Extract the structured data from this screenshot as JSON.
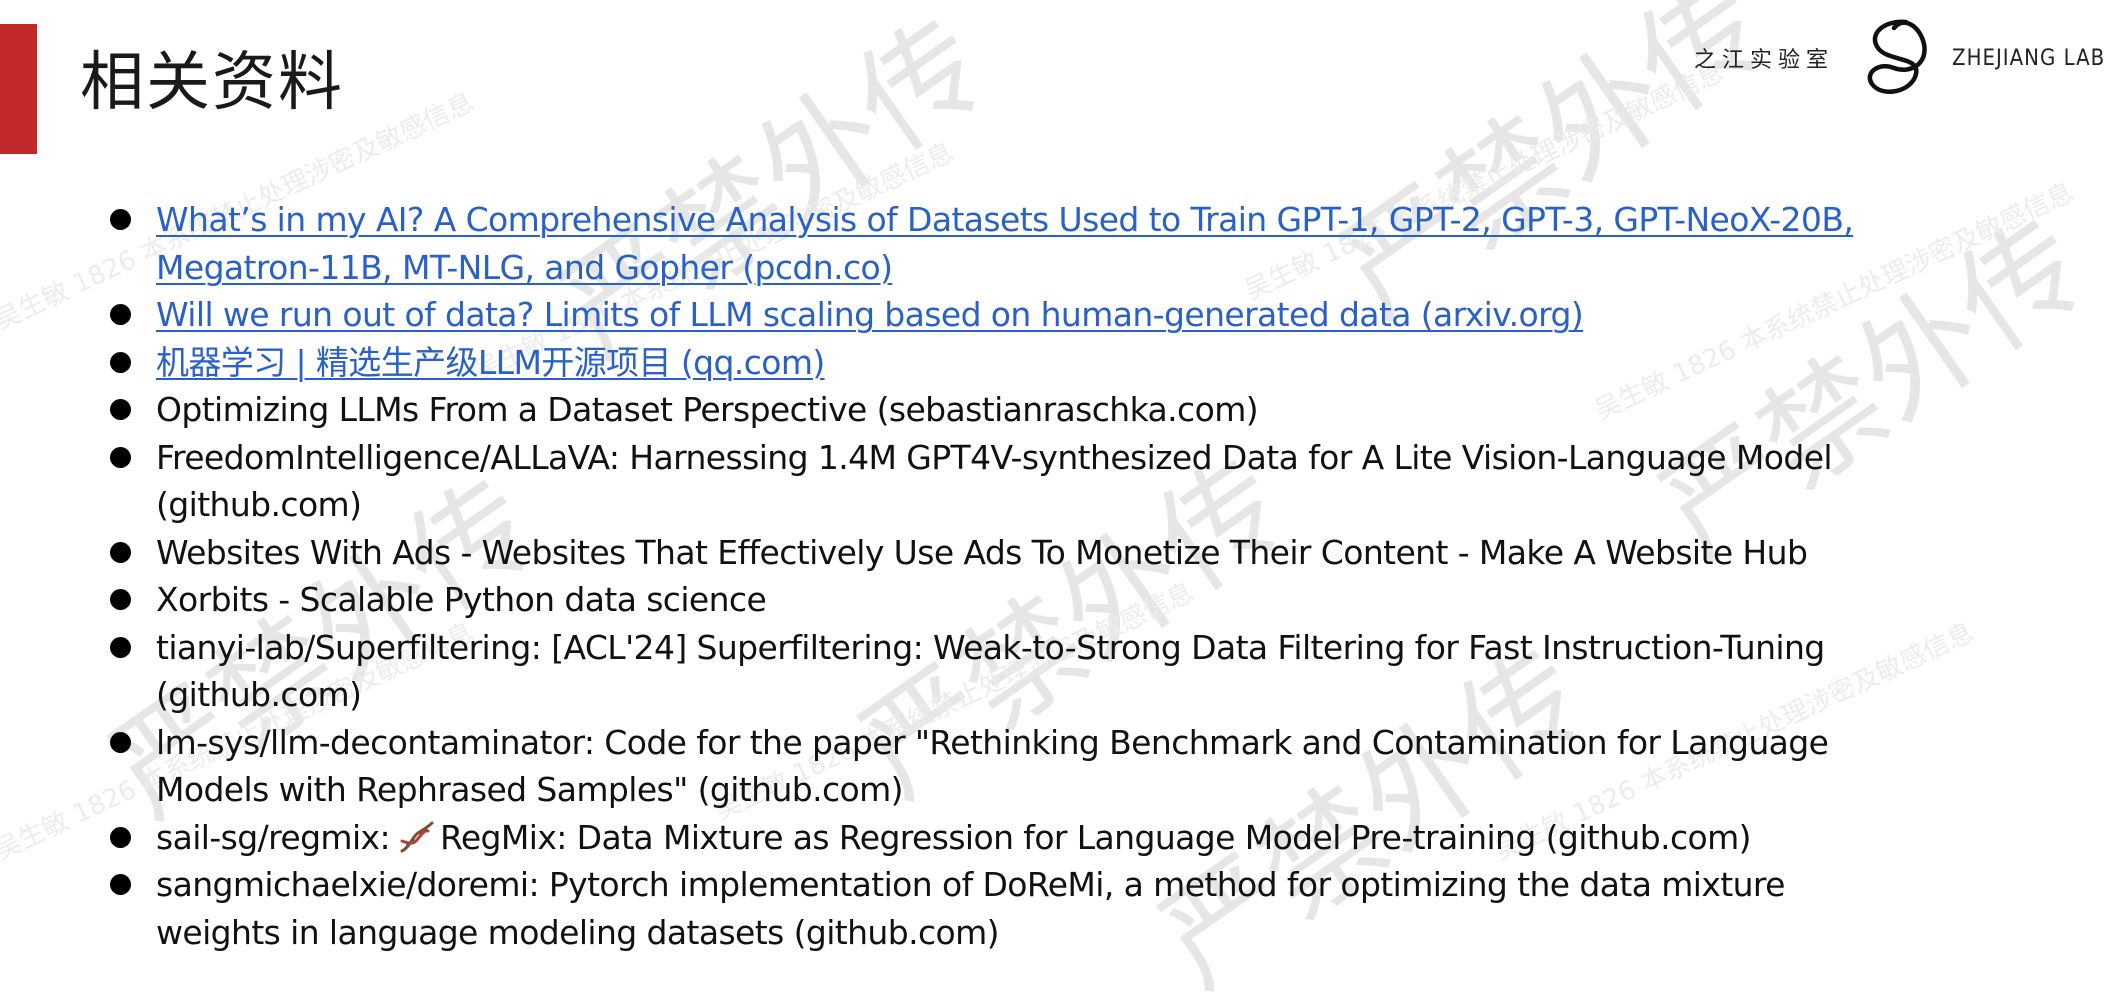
{
  "slide": {
    "title": "相关资料",
    "accent_color": "#c0282a",
    "link_color": "#2a61c6"
  },
  "logo": {
    "cn_name": "之江实验室",
    "en_name": "ZHEJIANG LAB"
  },
  "watermark": {
    "large_text": "严禁外传",
    "small_text": "吴生敏 1826 本系统禁止处理涉密及敏感信息"
  },
  "references": [
    {
      "text": "What’s in my AI? A Comprehensive Analysis of Datasets Used to Train GPT-1, GPT-2, GPT-3, GPT-NeoX-20B, Megatron-11B, MT-NLG, and Gopher (pcdn.co)",
      "is_link": true
    },
    {
      "text": "Will we run out of data? Limits of LLM scaling based on human-generated data (arxiv.org)",
      "is_link": true
    },
    {
      "text": "机器学习 | 精选生产级LLM开源项目 (qq.com)",
      "is_link": true
    },
    {
      "text": "Optimizing LLMs From a Dataset Perspective (sebastianraschka.com)",
      "is_link": false
    },
    {
      "text": "FreedomIntelligence/ALLaVA: Harnessing 1.4M GPT4V-synthesized Data for A Lite Vision-Language Model (github.com)",
      "is_link": false
    },
    {
      "text": "Websites With Ads - Websites That Effectively Use Ads To Monetize Their Content - Make A Website Hub",
      "is_link": false
    },
    {
      "text": "Xorbits - Scalable Python data science",
      "is_link": false
    },
    {
      "text": "tianyi-lab/Superfiltering: [ACL'24] Superfiltering: Weak-to-Strong Data Filtering for Fast Instruction-Tuning (github.com)",
      "is_link": false
    },
    {
      "text": "lm-sys/llm-decontaminator: Code for the paper \"Rethinking Benchmark and Contamination for Language Models with Rephrased Samples\" (github.com)",
      "is_link": false
    },
    {
      "text_before": "sail-sg/regmix:",
      "icon": "dna-icon",
      "text_after": "RegMix: Data Mixture as Regression for Language Model Pre-training (github.com)",
      "is_link": false
    },
    {
      "text": "sangmichaelxie/doremi: Pytorch implementation of DoReMi, a method for optimizing the data mixture weights in language modeling datasets (github.com)",
      "is_link": false
    }
  ]
}
